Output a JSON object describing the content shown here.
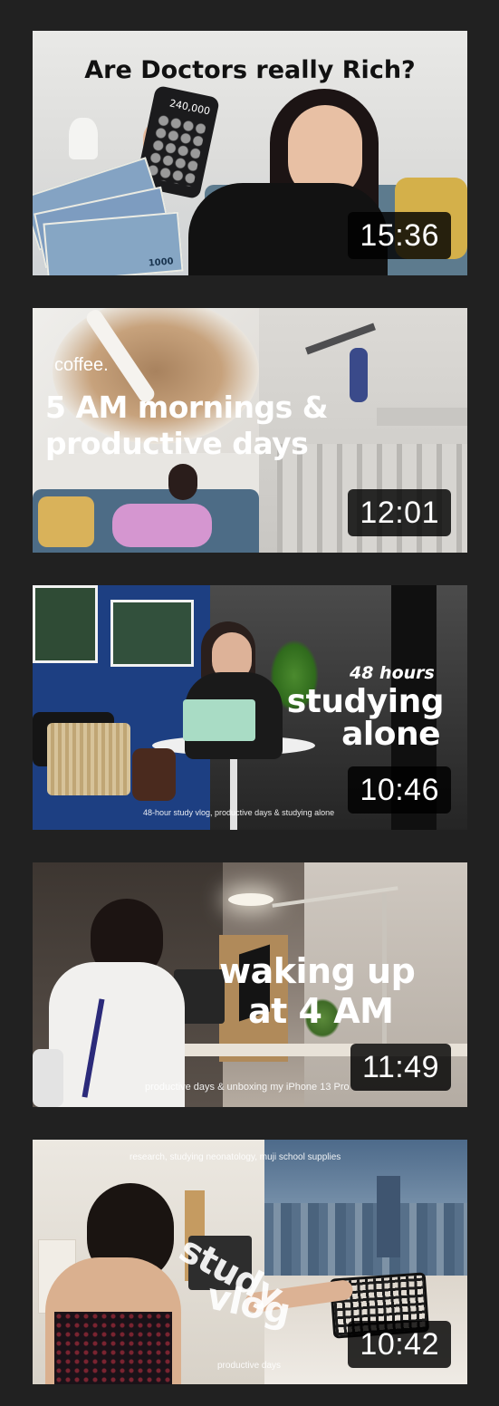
{
  "videos": [
    {
      "title_overlay": "Are Doctors really Rich?",
      "calculator_display": "240,000",
      "banknote_value": "1000",
      "duration": "15:36"
    },
    {
      "title_small": "coffee.",
      "title_line1": "5 AM mornings  &",
      "title_line2": "productive days",
      "duration": "12:01"
    },
    {
      "title_line1": "48 hours",
      "title_line2": "studying",
      "title_line3": "alone",
      "caption": "48-hour study vlog, productive days & studying alone",
      "duration": "10:46"
    },
    {
      "title_line1": "waking up",
      "title_line2": "at 4 AM",
      "caption": "productive days & unboxing my iPhone 13 Pro",
      "duration": "11:49"
    },
    {
      "caption_top": "research, studying neonatology, muji school supplies",
      "title_line1": "study",
      "title_line2": "vlog",
      "caption_bottom": "productive days",
      "duration": "10:42"
    }
  ]
}
